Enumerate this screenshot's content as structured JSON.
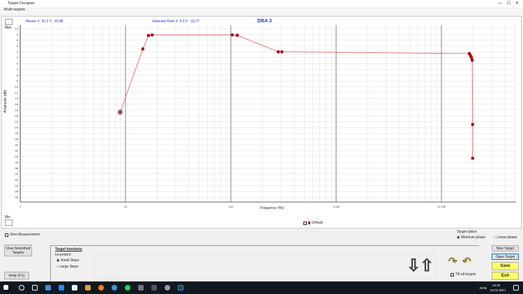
{
  "window": {
    "title": "Target Designer",
    "menu": "Multi targets"
  },
  "chart_header": {
    "mouse": "Mouse  X: 50.3   Y: -32.88",
    "selected": "Selected Point   X: 8.9   Y: -18.77",
    "name": "DBA 3"
  },
  "labels": {
    "max": "Max",
    "min": "Min",
    "legend": "Default"
  },
  "chart_data": {
    "type": "line",
    "xlabel": "Frequency (Hz)",
    "ylabel": "Amplitude (dB)",
    "xscale": "log",
    "xlim": [
      1,
      50000
    ],
    "ylim": [
      -48,
      10
    ],
    "xticks": [
      "1",
      "10",
      "100",
      "1 000",
      "10 000"
    ],
    "yticks": [
      10,
      8,
      6,
      4,
      2,
      0,
      -2,
      -4,
      -6,
      -8,
      -10,
      -12,
      -14,
      -16,
      -18,
      -20,
      -22,
      -24,
      -26,
      -28,
      -30,
      -32,
      -34,
      -36,
      -38,
      -40,
      -42,
      -44,
      -46,
      -48
    ],
    "series": [
      {
        "name": "Default",
        "color": "#cc0000",
        "x": [
          8.9,
          14.6,
          16.5,
          17.9,
          103,
          115,
          282,
          305,
          18400,
          18900,
          19300,
          19600,
          19800,
          19800
        ],
        "y": [
          -18.77,
          3,
          7.6,
          7.8,
          7.8,
          7.7,
          2,
          2,
          1.4,
          0.7,
          0,
          -0.9,
          -23,
          -34.6
        ]
      }
    ]
  },
  "controls": {
    "view_measurement": "View Measurement",
    "target_option": "Target option",
    "minimum_phase": "Minimum phase",
    "linear_phase": "Linear phase",
    "view_smoothed": "View Smoothed Targets",
    "help": "Help (F1)",
    "target_functions": "Target functions",
    "increment": "Increment",
    "small_steps": "Small Steps",
    "large_steps": "Large Steps",
    "tilt_all": "Tilt all targets",
    "new_target": "New Target",
    "open_target": "Open Target",
    "save": "Save",
    "exit": "Exit"
  },
  "taskbar": {
    "time": "14:32",
    "date": "22.01.2017",
    "lang": "NOB"
  }
}
